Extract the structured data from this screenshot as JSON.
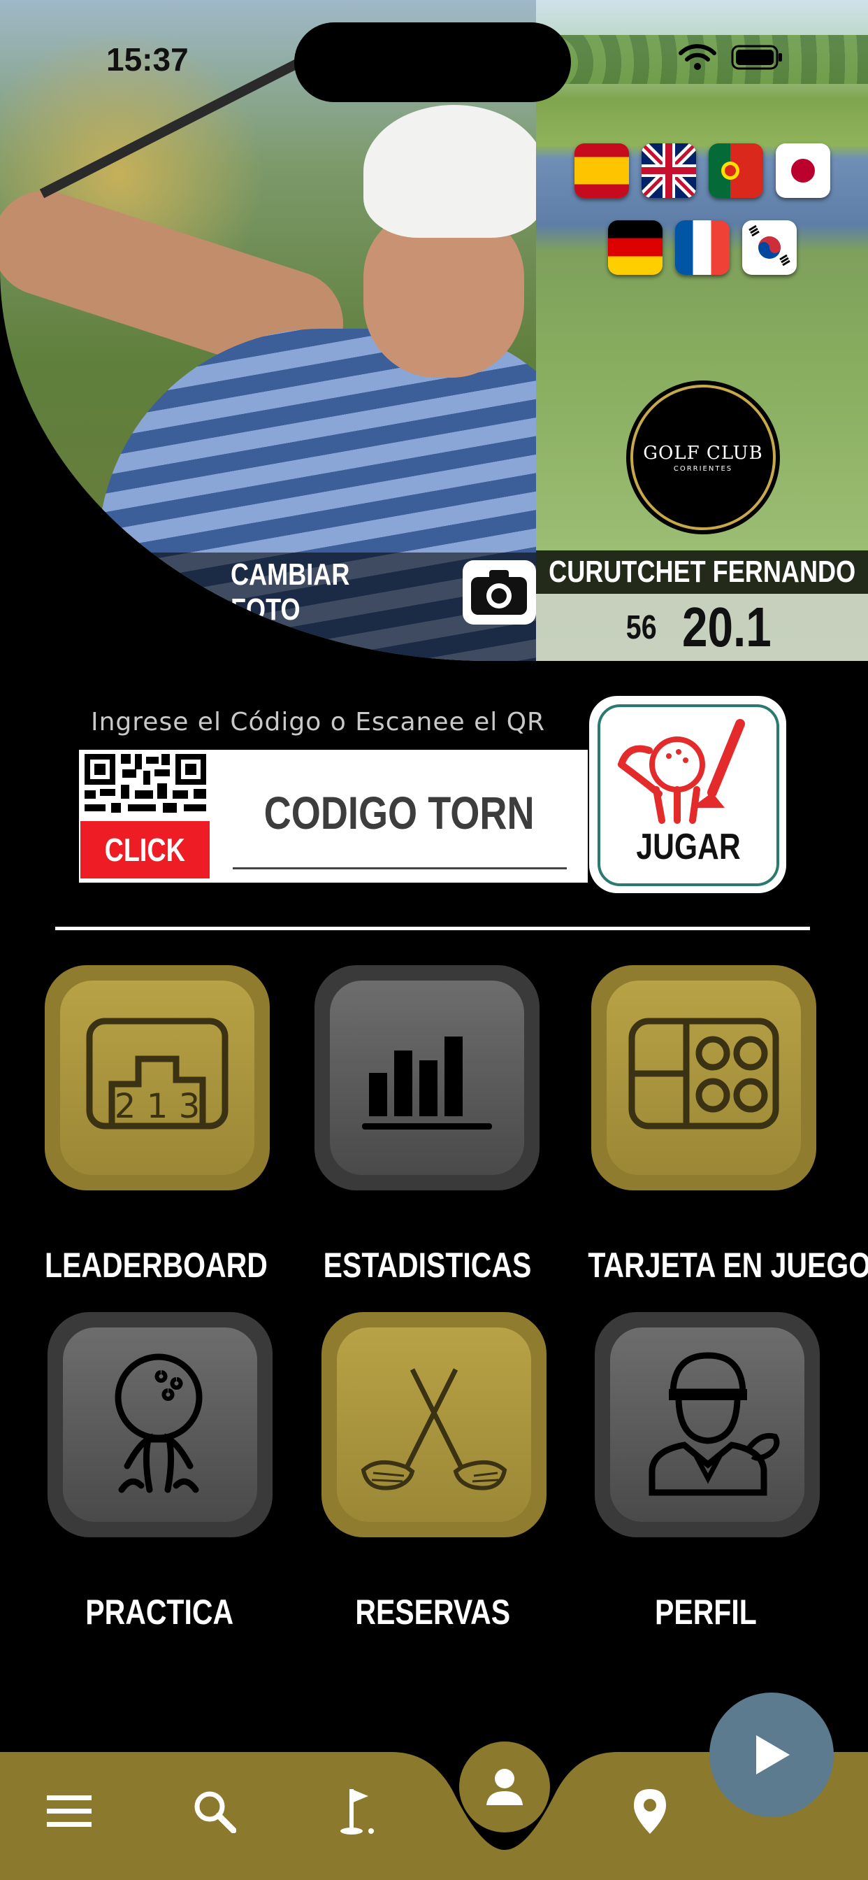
{
  "status_bar": {
    "time": "15:37"
  },
  "profile": {
    "change_photo_label": "CAMBIAR FOTO",
    "player_name": "CURUTCHET FERNANDO",
    "player_number": "56",
    "handicap": "20.1",
    "club_logo": {
      "line1": "GOLF CLUB",
      "line2": "CORRIENTES"
    }
  },
  "languages": [
    {
      "name": "spain-flag"
    },
    {
      "name": "uk-flag"
    },
    {
      "name": "portugal-flag"
    },
    {
      "name": "japan-flag"
    },
    {
      "name": "germany-flag"
    },
    {
      "name": "france-flag"
    },
    {
      "name": "korea-flag"
    }
  ],
  "tournament": {
    "hint": "Ingrese el Código o Escanee el QR",
    "qr_click_label": "CLICK",
    "code_placeholder": "CODIGO TORNEO",
    "play_label": "JUGAR"
  },
  "menu": {
    "leaderboard": "LEADERBOARD",
    "estadisticas": "ESTADISTICAS",
    "tarjeta": "TARJETA EN JUEGO",
    "practica": "PRACTICA",
    "reservas": "RESERVAS",
    "perfil": "PERFIL"
  },
  "colors": {
    "gold": "#b8a246",
    "nav_gold": "#8b7a2d",
    "play_fab": "#5c7b8e",
    "click_red": "#ee1c24"
  },
  "bottom_nav": [
    "menu-icon",
    "search-icon",
    "golf-flag-icon",
    "user-icon",
    "location-icon"
  ]
}
